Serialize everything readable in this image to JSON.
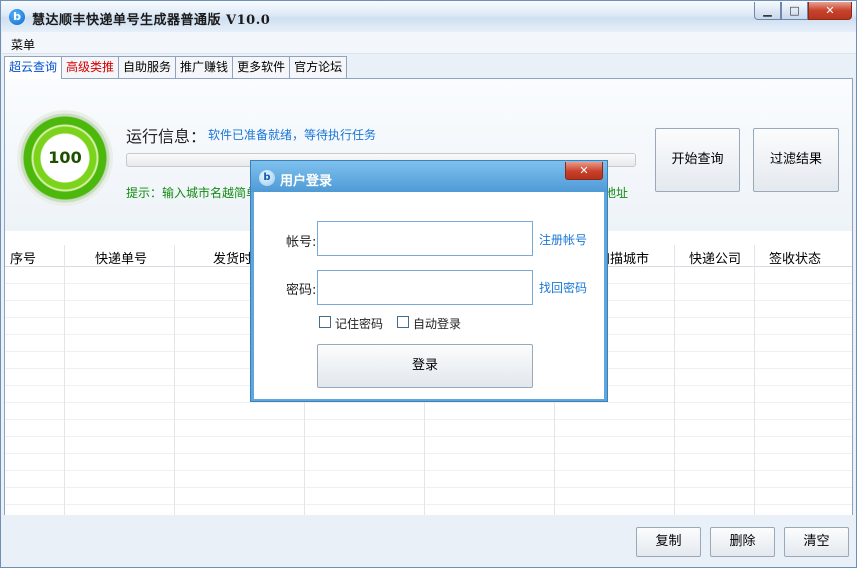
{
  "window": {
    "title": "慧达顺丰快递单号生成器普通版 V10.0",
    "icon": "app-logo-icon"
  },
  "window_controls": {
    "minimize": "▁",
    "maximize": "□",
    "close": "✕"
  },
  "menu": {
    "label": "菜单"
  },
  "tabs": [
    {
      "label": "超云查询",
      "active": true
    },
    {
      "label": "高级类推",
      "color": "#d40000"
    },
    {
      "label": "自助服务"
    },
    {
      "label": "推广赚钱"
    },
    {
      "label": "更多软件"
    },
    {
      "label": "官方论坛"
    }
  ],
  "gauge": {
    "value": "100"
  },
  "run": {
    "label": "运行信息：",
    "status": "软件已准备就绪，等待执行任务",
    "progress": 0,
    "hint": "提示：输入城市名越简单",
    "hint_tail": "地址"
  },
  "actions": {
    "query": "开始查询",
    "filter": "过滤结果"
  },
  "grid": {
    "columns": [
      "序号",
      "快递单号",
      "发货时",
      "扫描城市",
      "快递公司",
      "签收状态"
    ]
  },
  "bottom": {
    "copy": "复制",
    "delete": "删除",
    "clear": "清空"
  },
  "dialog": {
    "title": "用户登录",
    "close": "✕",
    "account_label": "帐号:",
    "account_value": "",
    "password_label": "密码:",
    "password_value": "",
    "register_link": "注册帐号",
    "recover_link": "找回密码",
    "remember_label": "记住密码",
    "auto_login_label": "自动登录",
    "login_button": "登录"
  },
  "colors": {
    "accent": "#1877d6",
    "hint": "#128a12",
    "gauge": "#4cb80c"
  }
}
